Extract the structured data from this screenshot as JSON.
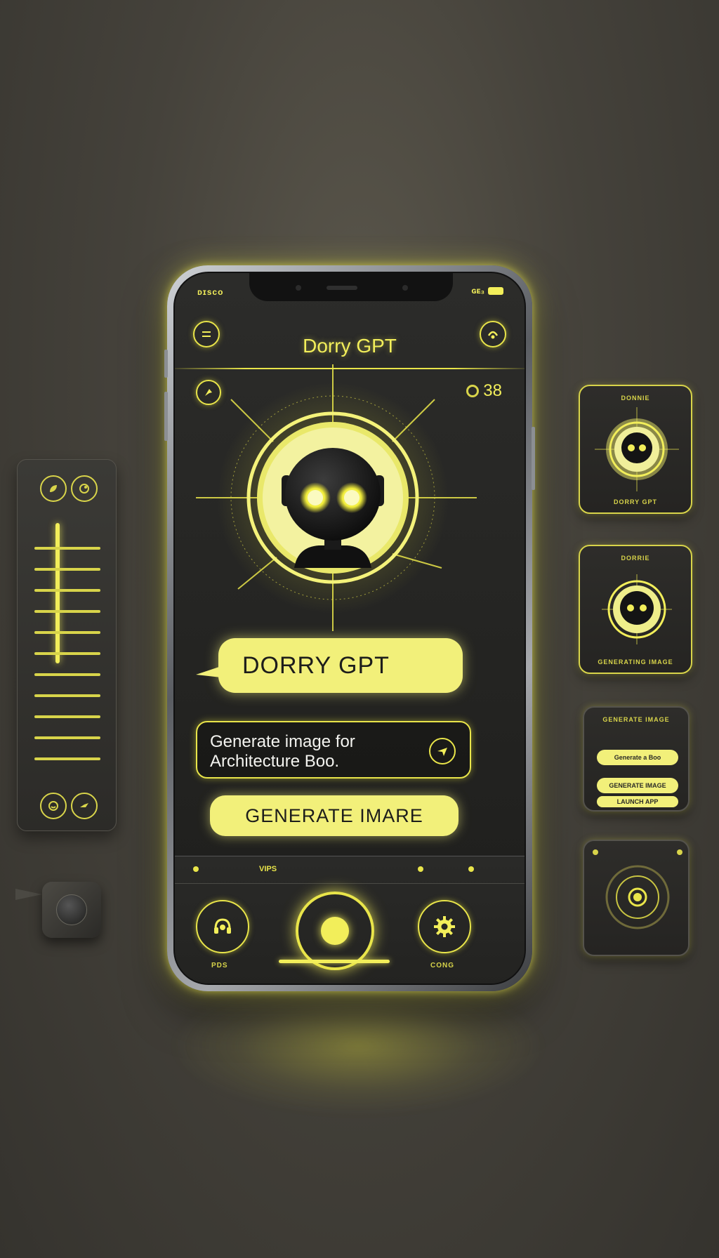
{
  "app": {
    "title": "Dorry GPT",
    "status_left": "ᴅɪsco",
    "status_right": "ɢᴇ₃",
    "counter": "38"
  },
  "chat": {
    "bubble_text": "DORRY GPT",
    "prompt_text": "Generate image for Architecture Boo.",
    "generate_label": "GENERATE IMARE"
  },
  "bottom_bar": {
    "label": "VIPS",
    "left_nav_label": "PDS",
    "right_nav_label": "CONG"
  },
  "widgets": {
    "w1_top": "DONNIE",
    "w1_bottom": "DORRY GPT",
    "w2_top": "DORRIE",
    "w2_bottom": "GENERATING IMAGE",
    "w3_top": "GENERATE IMAGE",
    "w3_pill1": "Generate a Boo",
    "w3_pill2": "GENERATE IMAGE",
    "w3_pill3": "LAUNCH APP"
  },
  "colors": {
    "accent": "#f2ee5a",
    "accent_soft": "#f2f07a",
    "background": "#45423b",
    "screen": "#262624"
  },
  "icons": {
    "menu": "menu-icon",
    "profile": "profile-icon",
    "share": "share-icon",
    "send": "send-icon",
    "voice": "headset-icon",
    "record": "record-icon",
    "settings": "gear-icon"
  }
}
